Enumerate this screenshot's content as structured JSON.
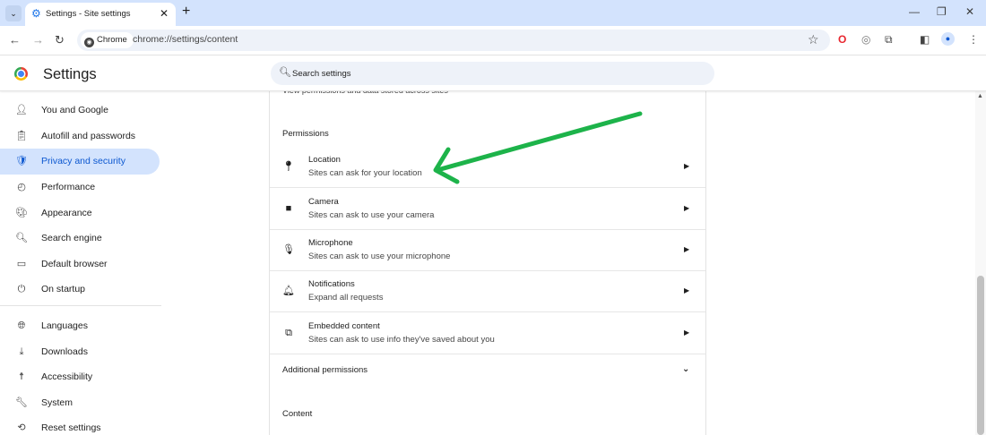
{
  "browser": {
    "tab_title": "Settings - Site settings",
    "tab_close": "✕",
    "new_tab": "+",
    "window_controls": {
      "minimize": "—",
      "restore": "❐",
      "close": "✕"
    },
    "nav": {
      "back": "←",
      "forward": "→",
      "reload": "↻"
    },
    "chip_label": "Chrome",
    "url": "chrome://settings/content",
    "bookmark_icon": "☆"
  },
  "settings": {
    "title": "Settings",
    "search_placeholder": "Search settings"
  },
  "sidebar": {
    "items": [
      {
        "label": "You and Google",
        "icon": "person-icon"
      },
      {
        "label": "Autofill and passwords",
        "icon": "clipboard-icon"
      },
      {
        "label": "Privacy and security",
        "icon": "shield-icon",
        "active": true
      },
      {
        "label": "Performance",
        "icon": "speedometer-icon"
      },
      {
        "label": "Appearance",
        "icon": "palette-icon"
      },
      {
        "label": "Search engine",
        "icon": "search-icon"
      },
      {
        "label": "Default browser",
        "icon": "browser-icon"
      },
      {
        "label": "On startup",
        "icon": "power-icon"
      },
      {
        "label": "Languages",
        "icon": "globe-icon"
      },
      {
        "label": "Downloads",
        "icon": "download-icon"
      },
      {
        "label": "Accessibility",
        "icon": "accessibility-icon"
      },
      {
        "label": "System",
        "icon": "wrench-icon"
      },
      {
        "label": "Reset settings",
        "icon": "reset-icon"
      }
    ]
  },
  "main": {
    "clipped_row_text": "View permissions and data stored across sites",
    "permissions_heading": "Permissions",
    "permissions": [
      {
        "title": "Location",
        "subtitle": "Sites can ask for your location",
        "icon": "location-pin-icon"
      },
      {
        "title": "Camera",
        "subtitle": "Sites can ask to use your camera",
        "icon": "camera-icon"
      },
      {
        "title": "Microphone",
        "subtitle": "Sites can ask to use your microphone",
        "icon": "microphone-icon"
      },
      {
        "title": "Notifications",
        "subtitle": "Expand all requests",
        "icon": "bell-icon"
      },
      {
        "title": "Embedded content",
        "subtitle": "Sites can ask to use info they've saved about you",
        "icon": "embedded-content-icon"
      }
    ],
    "additional_permissions": "Additional permissions",
    "content_heading": "Content"
  },
  "colors": {
    "accent": "#0b57d0",
    "active_bg": "#d3e3fd",
    "annotation_arrow": "#1db34a"
  }
}
